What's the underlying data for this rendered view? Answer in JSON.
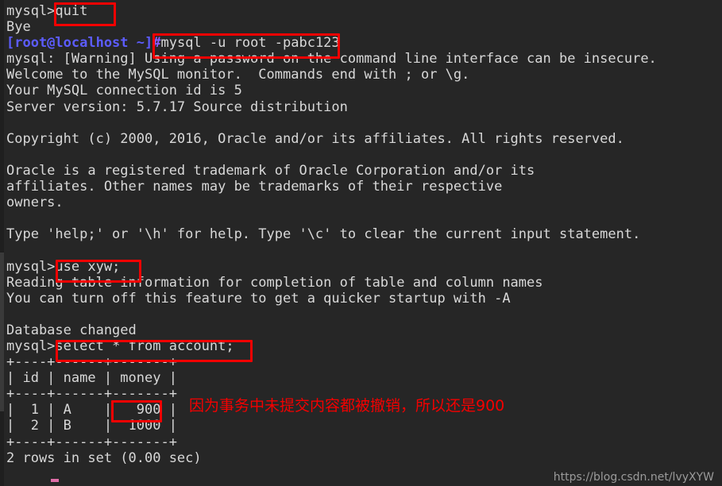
{
  "terminal": {
    "title": "mysql-client-terminal",
    "background_color": "#262626",
    "text_color": "#d8d8d8",
    "prompt_color": "#5c5cfe",
    "annotation_color": "#f40000",
    "mysql_prompt": "mysql>",
    "shell_prompt_user_host": "[root@localhost ~]",
    "shell_prompt_symbol": "#",
    "lines": [
      {
        "id": "l1",
        "type": "mysql-prompt",
        "prompt": "mysql>",
        "text": "quit"
      },
      {
        "id": "l2",
        "type": "output",
        "text": "Bye"
      },
      {
        "id": "l3",
        "type": "shell-prompt",
        "prompt": "[root@localhost ~]",
        "symbol": "#",
        "text": "mysql -u root -pabc123"
      },
      {
        "id": "l4",
        "type": "output",
        "text": "mysql: [Warning] Using a password on the command line interface can be insecure."
      },
      {
        "id": "l5",
        "type": "output",
        "text": "Welcome to the MySQL monitor.  Commands end with ; or \\g."
      },
      {
        "id": "l6",
        "type": "output",
        "text": "Your MySQL connection id is 5"
      },
      {
        "id": "l7",
        "type": "output",
        "text": "Server version: 5.7.17 Source distribution"
      },
      {
        "id": "l8",
        "type": "blank",
        "text": ""
      },
      {
        "id": "l9",
        "type": "output",
        "text": "Copyright (c) 2000, 2016, Oracle and/or its affiliates. All rights reserved."
      },
      {
        "id": "l10",
        "type": "blank",
        "text": ""
      },
      {
        "id": "l11",
        "type": "output",
        "text": "Oracle is a registered trademark of Oracle Corporation and/or its"
      },
      {
        "id": "l12",
        "type": "output",
        "text": "affiliates. Other names may be trademarks of their respective"
      },
      {
        "id": "l13",
        "type": "output",
        "text": "owners."
      },
      {
        "id": "l14",
        "type": "blank",
        "text": ""
      },
      {
        "id": "l15",
        "type": "output",
        "text": "Type 'help;' or '\\h' for help. Type '\\c' to clear the current input statement."
      },
      {
        "id": "l16",
        "type": "blank",
        "text": ""
      },
      {
        "id": "l17",
        "type": "mysql-prompt",
        "prompt": "mysql>",
        "text": "use xyw;"
      },
      {
        "id": "l18",
        "type": "output",
        "text": "Reading table information for completion of table and column names"
      },
      {
        "id": "l19",
        "type": "output",
        "text": "You can turn off this feature to get a quicker startup with -A"
      },
      {
        "id": "l20",
        "type": "blank",
        "text": ""
      },
      {
        "id": "l21",
        "type": "output",
        "text": "Database changed"
      },
      {
        "id": "l22",
        "type": "mysql-prompt",
        "prompt": "mysql>",
        "text": "select * from account;"
      },
      {
        "id": "l23",
        "type": "output",
        "text": "+----+------+-------+"
      },
      {
        "id": "l24",
        "type": "output",
        "text": "| id | name | money |"
      },
      {
        "id": "l25",
        "type": "output",
        "text": "+----+------+-------+"
      },
      {
        "id": "l26",
        "type": "output",
        "text": "|  1 | A    |   900 |"
      },
      {
        "id": "l27",
        "type": "output",
        "text": "|  2 | B    |  1000 |"
      },
      {
        "id": "l28",
        "type": "output",
        "text": "+----+------+-------+"
      },
      {
        "id": "l29",
        "type": "output",
        "text": "2 rows in set (0.00 sec)"
      },
      {
        "id": "l30",
        "type": "blank",
        "text": ""
      }
    ],
    "result_table": {
      "columns": [
        "id",
        "name",
        "money"
      ],
      "rows": [
        [
          "1",
          "A",
          "900"
        ],
        [
          "2",
          "B",
          "1000"
        ]
      ],
      "footer": "2 rows in set (0.00 sec)"
    }
  },
  "annotations": {
    "highlight_boxes": [
      {
        "name": "quit-command",
        "text": "quit"
      },
      {
        "name": "mysql-login-command",
        "text": "mysql -u root -pabc123"
      },
      {
        "name": "use-database-command",
        "text": "use xyw;"
      },
      {
        "name": "select-query-command",
        "text": "select * from account;"
      },
      {
        "name": "money-value-900",
        "text": "900"
      }
    ],
    "note_text": "因为事务中未提交内容都被撤销，所以还是900"
  },
  "watermark": {
    "text": "https://blog.csdn.net/lvyXYW"
  }
}
